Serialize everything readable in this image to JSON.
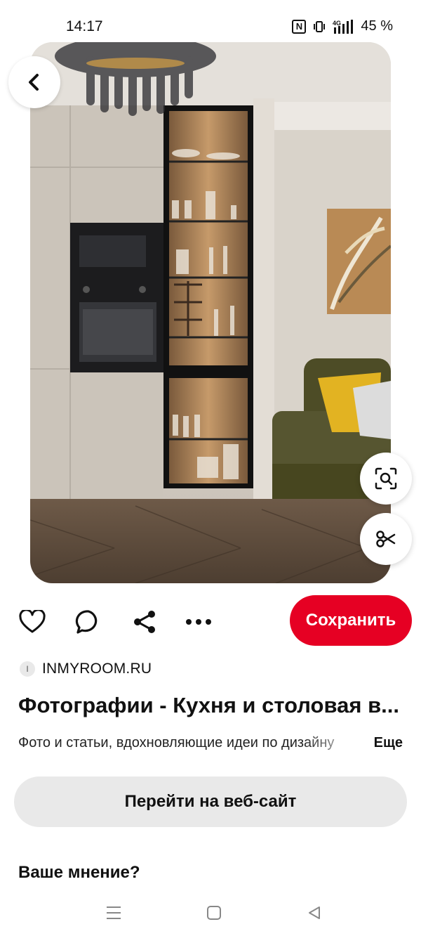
{
  "status_bar": {
    "time": "14:17",
    "nfc": "N",
    "network": "4G",
    "battery": "45 %"
  },
  "pin": {
    "image_description": "Kitchen interior with illuminated glass display cabinet",
    "source_initial": "I",
    "source": "INMYROOM.RU",
    "title": "Фотографии - Кухня и столовая в...",
    "description": "Фото и статьи, вдохновляющие идеи по дизайну",
    "more_label": "Еще"
  },
  "actions": {
    "like_icon": "heart-icon",
    "comment_icon": "comment-icon",
    "share_icon": "share-icon",
    "more_icon": "more-dots-icon",
    "save_label": "Сохранить"
  },
  "visit_label": "Перейти на веб-сайт",
  "feedback_heading": "Ваше мнение?",
  "colors": {
    "accent": "#e60023",
    "secondary_button": "#e9e9e9"
  }
}
